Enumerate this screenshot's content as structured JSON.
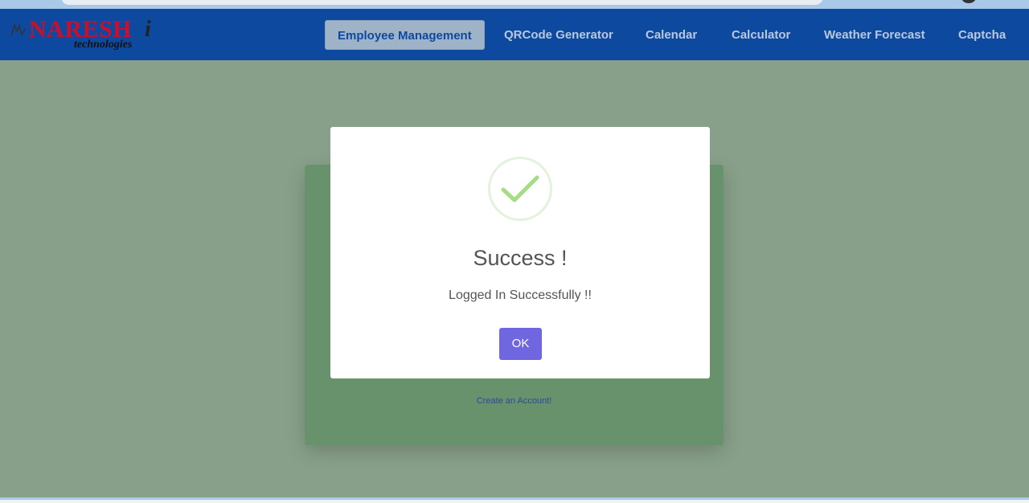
{
  "brand": {
    "logo_text": "NARESH",
    "logo_suffix": "i",
    "logo_subtitle": "technologies"
  },
  "nav": {
    "items": [
      {
        "label": "Employee Management",
        "active": true
      },
      {
        "label": "QRCode Generator",
        "active": false
      },
      {
        "label": "Calendar",
        "active": false
      },
      {
        "label": "Calculator",
        "active": false
      },
      {
        "label": "Weather Forecast",
        "active": false
      },
      {
        "label": "Captcha",
        "active": false
      }
    ]
  },
  "login_card": {
    "create_account_link": "Create an Account!"
  },
  "modal": {
    "icon": "success-check-icon",
    "title": "Success !",
    "message": "Logged In Successfully !!",
    "ok_label": "OK"
  },
  "colors": {
    "navbar": "#0e49a0",
    "logo_red": "#c8102e",
    "overlay_background": "#88a08a",
    "card_green": "#67926b",
    "ok_button": "#7066e0",
    "check_green": "#a5dc86"
  }
}
